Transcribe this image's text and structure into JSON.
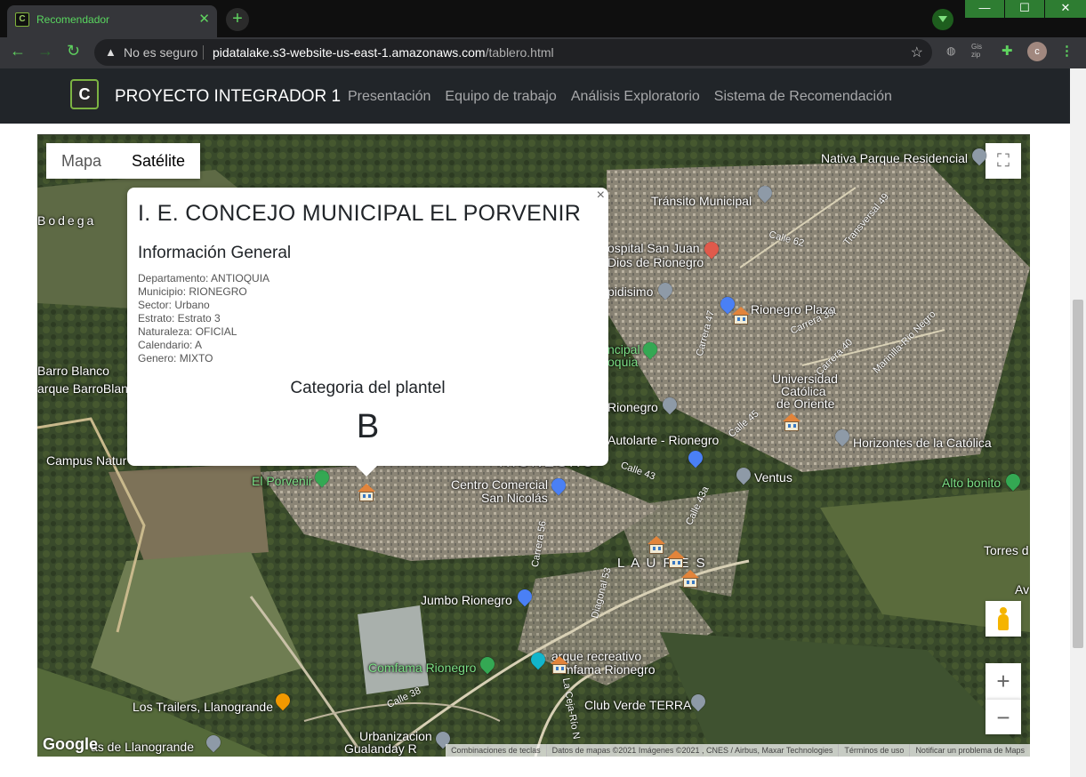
{
  "browser": {
    "tab_title": "Recomendador",
    "tab_close": "✕",
    "new_tab": "+",
    "security_label": "No es seguro",
    "url_host": "pidatalake.s3-website-us-east-1.amazonaws.com",
    "url_path": "/tablero.html",
    "avatar_letter": "c",
    "window_buttons": [
      "—",
      "☐",
      "✕"
    ],
    "ext_label": "Gis zip"
  },
  "navbar": {
    "logo_text": "C",
    "brand": "PROYECTO INTEGRADOR 1",
    "links": [
      "Presentación",
      "Equipo de trabajo",
      "Análisis Exploratorio",
      "Sistema de Recomendación"
    ]
  },
  "map": {
    "type_toggle": [
      "Mapa",
      "Satélite"
    ],
    "selected_type": "Satélite",
    "zoom_in": "+",
    "zoom_out": "−",
    "fullscreen": "⛶",
    "google": "Google",
    "footer": [
      "Combinaciones de teclas",
      "Datos de mapas ©2021 Imágenes ©2021 , CNES / Airbus, Maxar Technologies",
      "Términos de uso",
      "Notificar un problema de Maps"
    ],
    "places": {
      "nativa": "Nativa Parque Residencial",
      "transito": "Tránsito Municipal",
      "hospital": "ospital San Juan",
      "hospital2": "Dios de Rionegro",
      "bodega": "Bodega",
      "rionegro_plaza": "Rionegro Plaza",
      "pidisimo": "pidisimo",
      "municipal": "ncipal",
      "municipal2": "oquia",
      "universidad": "Universidad",
      "universidad2": "Católica",
      "universidad3": "de Oriente",
      "barro_blanco": "Barro Blanco",
      "parque_barro": "arque BarroBlanc",
      "rionegro": "Rionegro",
      "autolarte": "Autolarte - Rionegro",
      "horizontes": "Horizontes de la Católica",
      "campus": "Campus Natur",
      "rionegro_city": "RIONEGRO",
      "ventus": "Ventus",
      "alto_bonito": "Alto bonito",
      "el_porvenir": "El Porvenir",
      "centro": "Centro Comercial",
      "centro2": "San Nicolás",
      "laureles": "L A U R E S",
      "torres": "Torres d",
      "av": "Av",
      "jumbo": "Jumbo Rionegro",
      "comfama": "Comfama Rionegro",
      "parque_rec": "arque recreativo",
      "parque_rec2": "mfama Rionegro",
      "los_trailers": "Los Trailers, Llanogrande",
      "club_verde": "Club Verde TERRA",
      "llanogrande": "as de Llanogrande",
      "urbanizacion": "Urbanizacion",
      "gualanday": "Gualanday R"
    },
    "streets": {
      "calle62": "Calle 62",
      "transversal49": "Transversal 49",
      "carrera47": "Carrera 47",
      "carrera39": "Carrera 39",
      "carrera40": "Carrera 40",
      "marinilla": "Marinilla-Rio Negro",
      "calle45": "Calle 45",
      "calle43": "Calle 43",
      "calle43a": "Calle 43a",
      "carrera56": "Carrera 56",
      "diagonal53": "Diagonal 53",
      "calle38": "Calle 38",
      "ceja": "La Ceja-Río N"
    }
  },
  "popup": {
    "close": "×",
    "title": "I. E. CONCEJO MUNICIPAL EL PORVENIR",
    "section": "Información General",
    "info": [
      "Departamento: ANTIOQUIA",
      "Municipio: RIONEGRO",
      "Sector: Urbano",
      "Estrato: Estrato 3",
      "Naturaleza: OFICIAL",
      "Calendario: A",
      "Genero: MIXTO"
    ],
    "category_label": "Categoria del plantel",
    "category_value": "B"
  }
}
